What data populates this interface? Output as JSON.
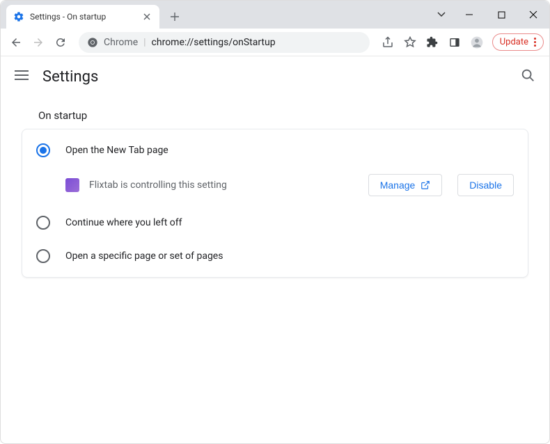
{
  "titlebar": {
    "tab_title": "Settings - On startup"
  },
  "toolbar": {
    "omnibox_prefix": "Chrome",
    "omnibox_url": "chrome://settings/onStartup",
    "update_label": "Update"
  },
  "header": {
    "title": "Settings"
  },
  "section": {
    "title": "On startup",
    "options": [
      {
        "label": "Open the New Tab page",
        "selected": true
      },
      {
        "label": "Continue where you left off",
        "selected": false
      },
      {
        "label": "Open a specific page or set of pages",
        "selected": false
      }
    ],
    "extension_notice": {
      "name": "Flixtab",
      "message": "Flixtab is controlling this setting",
      "manage_label": "Manage",
      "disable_label": "Disable"
    }
  }
}
